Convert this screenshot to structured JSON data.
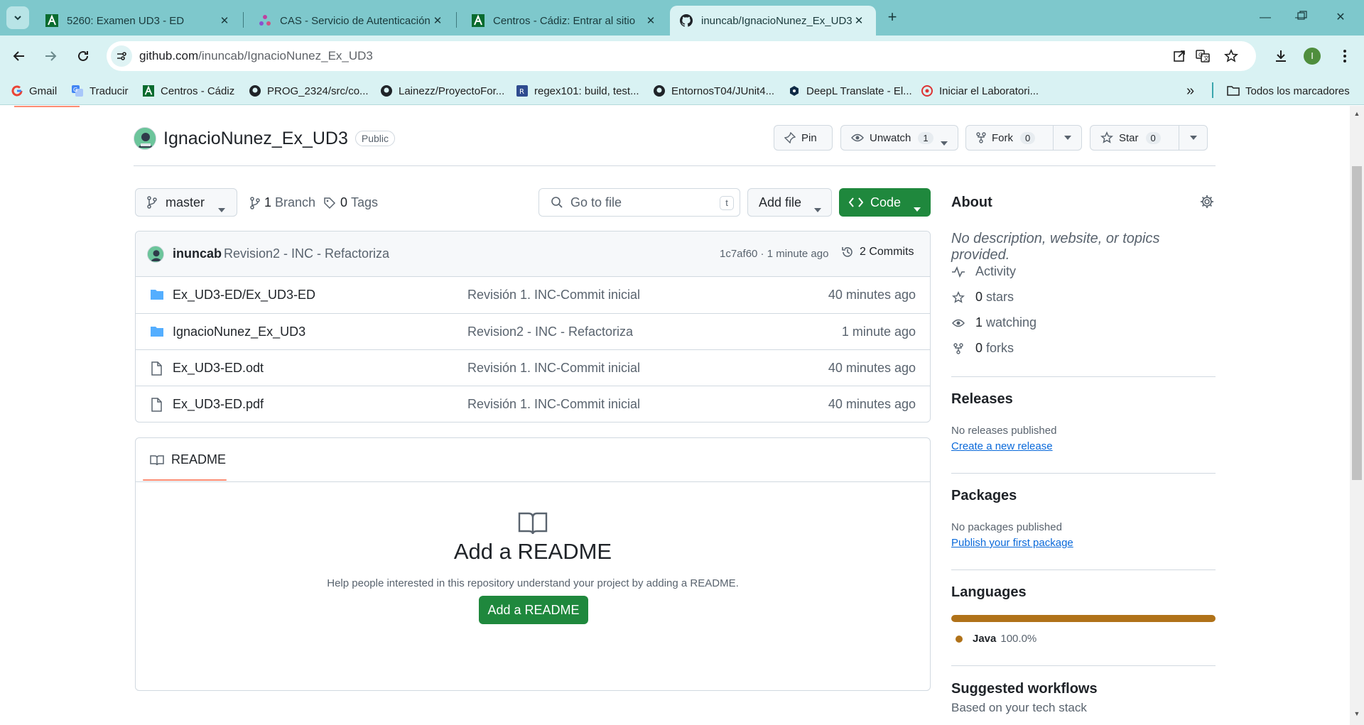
{
  "browser": {
    "tabs": [
      {
        "title": "5260: Examen UD3 - ED",
        "active": false
      },
      {
        "title": "CAS - Servicio de Autenticación",
        "active": false
      },
      {
        "title": "Centros - Cádiz: Entrar al sitio",
        "active": false
      },
      {
        "title": "inuncab/IgnacioNunez_Ex_UD3",
        "active": true
      }
    ],
    "url_host": "github.com",
    "url_path": "/inuncab/IgnacioNunez_Ex_UD3",
    "profile_initial": "I",
    "bookmarks": [
      "Gmail",
      "Traducir",
      "Centros - Cádiz",
      "PROG_2324/src/co...",
      "Lainezz/ProyectoFor...",
      "regex101: build, test...",
      "EntornosT04/JUnit4...",
      "DeepL Translate - El...",
      "Iniciar el Laboratori..."
    ],
    "all_bookmarks": "Todos los marcadores",
    "bookmark_overflow": "»"
  },
  "repo": {
    "name": "IgnacioNunez_Ex_UD3",
    "visibility": "Public",
    "actions": {
      "pin": "Pin",
      "unwatch": "Unwatch",
      "unwatch_count": "1",
      "fork": "Fork",
      "fork_count": "0",
      "star": "Star",
      "star_count": "0"
    },
    "branch": "master",
    "branches": {
      "count": "1",
      "label": "Branch"
    },
    "tags": {
      "count": "0",
      "label": "Tags"
    },
    "goto_placeholder": "Go to file",
    "goto_shortcut": "t",
    "add_file": "Add file",
    "code": "Code",
    "latest_commit": {
      "user": "inuncab",
      "message": "Revision2 - INC - Refactoriza",
      "hash_time": "1c7af60 · 1 minute ago",
      "commits": "2 Commits"
    },
    "files": [
      {
        "type": "folder",
        "name": "Ex_UD3-ED/Ex_UD3-ED",
        "message": "Revisión 1. INC-Commit inicial",
        "time": "40 minutes ago"
      },
      {
        "type": "folder",
        "name": "IgnacioNunez_Ex_UD3",
        "message": "Revision2 - INC - Refactoriza",
        "time": "1 minute ago"
      },
      {
        "type": "file",
        "name": "Ex_UD3-ED.odt",
        "message": "Revisión 1. INC-Commit inicial",
        "time": "40 minutes ago"
      },
      {
        "type": "file",
        "name": "Ex_UD3-ED.pdf",
        "message": "Revisión 1. INC-Commit inicial",
        "time": "40 minutes ago"
      }
    ],
    "readme": {
      "tab": "README",
      "title": "Add a README",
      "subtitle": "Help people interested in this repository understand your project by adding a README.",
      "button": "Add a README"
    }
  },
  "sidebar": {
    "about": {
      "title": "About",
      "description": "No description, website, or topics provided.",
      "activity": "Activity",
      "stars_count": "0",
      "stars_label": "stars",
      "watching_count": "1",
      "watching_label": "watching",
      "forks_count": "0",
      "forks_label": "forks"
    },
    "releases": {
      "title": "Releases",
      "empty": "No releases published",
      "link": "Create a new release"
    },
    "packages": {
      "title": "Packages",
      "empty": "No packages published",
      "link": "Publish your first package"
    },
    "languages": {
      "title": "Languages",
      "items": [
        {
          "name": "Java",
          "percent": "100.0%",
          "color": "#b07219"
        }
      ]
    },
    "suggested": {
      "title": "Suggested workflows",
      "subtitle": "Based on your tech stack"
    }
  },
  "colors": {
    "browser_accent": "#7ec8cc",
    "primary_green": "#1f883d",
    "link_blue": "#0969da",
    "java": "#b07219",
    "tab_underline": "#fd8c73"
  }
}
